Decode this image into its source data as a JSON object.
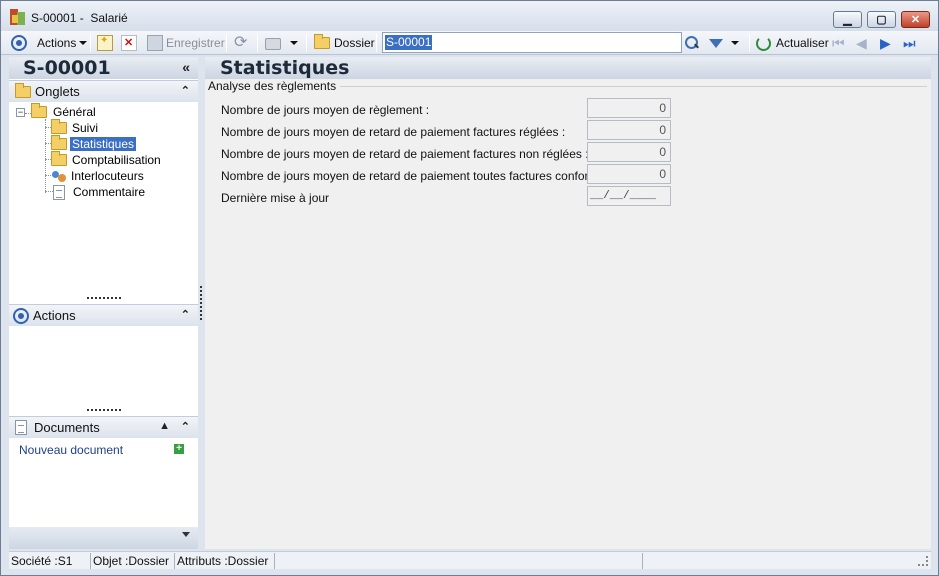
{
  "window": {
    "title": "S-00001 -  Salarié",
    "minimize_glyph": "▁",
    "maximize_glyph": "▢",
    "close_glyph": "✕"
  },
  "toolbar": {
    "actions_label": "Actions",
    "save_label": "Enregistrer",
    "folder_label": "Dossier",
    "search_value": "S-00001",
    "refresh_label": "Actualiser",
    "icons": [
      "actions-icon",
      "new-icon",
      "delete-icon",
      "save-icon",
      "sync-icon",
      "print-icon",
      "folder-icon",
      "search-icon",
      "filter-icon",
      "refresh-icon",
      "first-icon",
      "previous-icon",
      "next-icon",
      "last-icon"
    ]
  },
  "left_panel": {
    "record_id": "S-00001",
    "collapse_glyph": "«",
    "tabs_section": {
      "label": "Onglets",
      "tree": {
        "root": "Général",
        "items": [
          {
            "label": "Suivi",
            "icon": "folder-icon",
            "selected": false
          },
          {
            "label": "Statistiques",
            "icon": "folder-open-icon",
            "selected": true
          },
          {
            "label": "Comptabilisation",
            "icon": "folder-icon",
            "selected": false
          },
          {
            "label": "Interlocuteurs",
            "icon": "contacts-icon",
            "selected": false
          },
          {
            "label": "Commentaire",
            "icon": "document-icon",
            "selected": false
          }
        ]
      }
    },
    "actions_section": {
      "label": "Actions"
    },
    "documents_section": {
      "label": "Documents",
      "new_document": "Nouveau document"
    }
  },
  "main": {
    "title": "Statistiques",
    "group_title": "Analyse des règlements",
    "fields": [
      {
        "label": "Nombre de jours moyen de règlement :",
        "value": "0"
      },
      {
        "label": "Nombre de jours moyen de retard de paiement factures réglées :",
        "value": "0"
      },
      {
        "label": "Nombre de jours moyen de retard de paiement factures non réglées :",
        "value": "0"
      },
      {
        "label": "Nombre de jours moyen de retard de paiement toutes factures confondues :",
        "value": "0"
      }
    ],
    "last_update": {
      "label": "Dernière mise à jour",
      "value": "__/__/____"
    }
  },
  "statusbar": {
    "company": "Société :S1",
    "object": "Objet :Dossier",
    "attributes": "Attributs :Dossier"
  },
  "colors": {
    "accent": "#3a6fc4",
    "header_gradient_top": "#e9edf3",
    "header_gradient_bottom": "#ccd5e2",
    "close_button": "#c0402a"
  }
}
